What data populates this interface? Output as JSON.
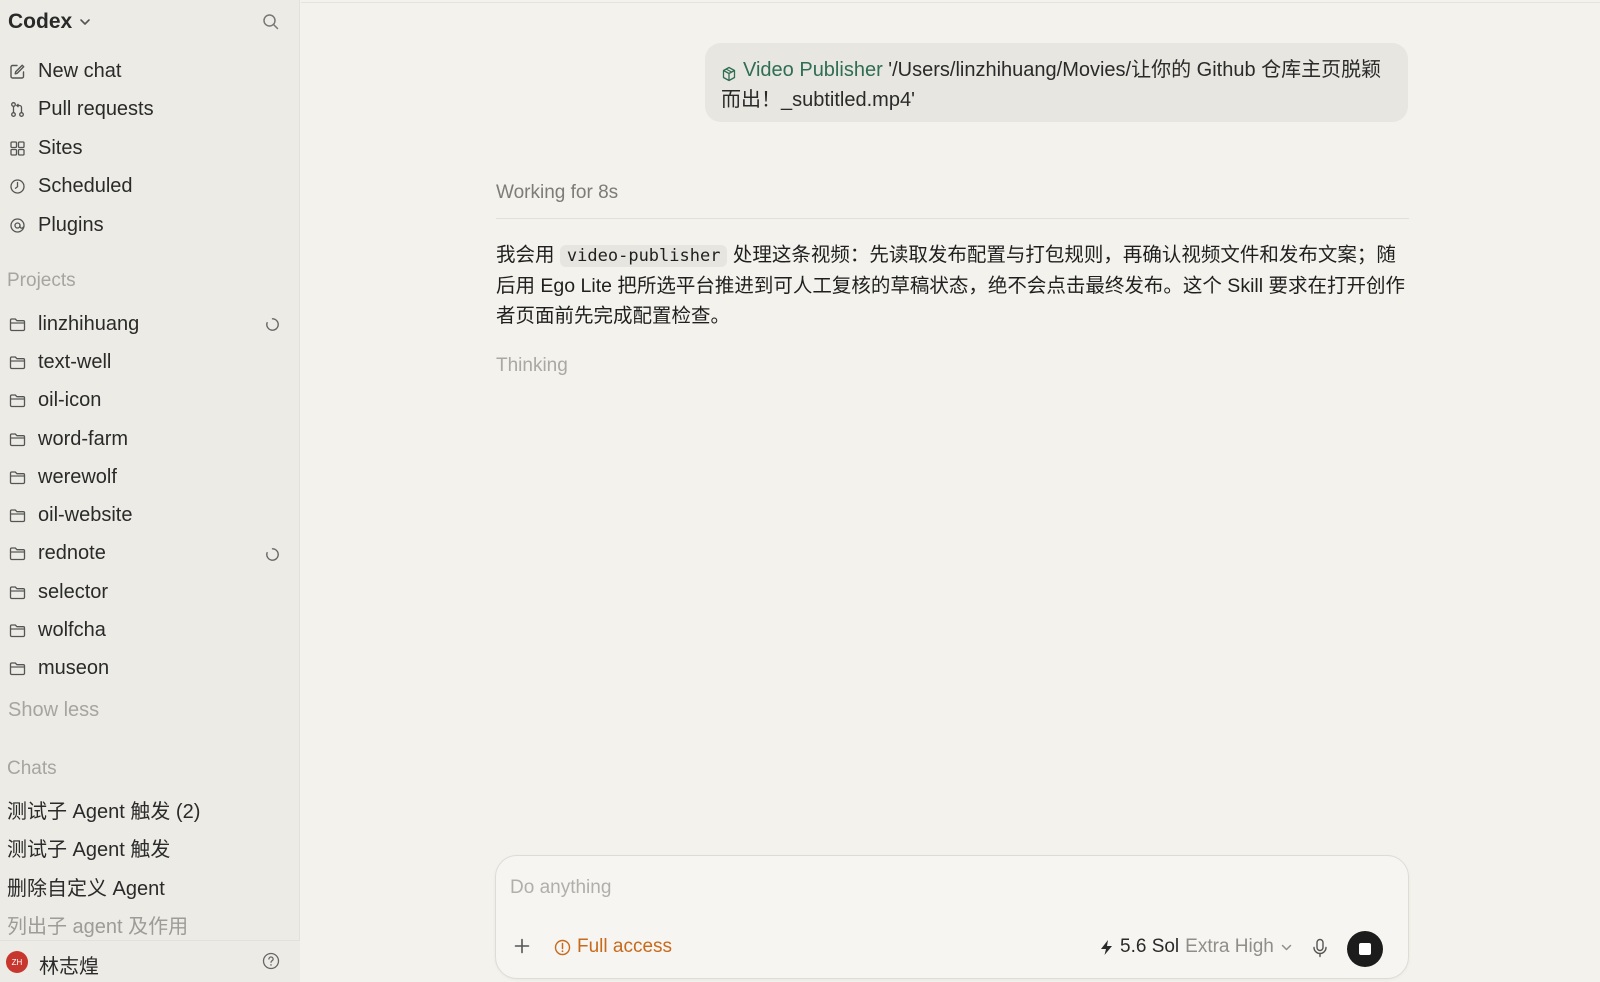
{
  "app": {
    "name": "Codex"
  },
  "sidebar": {
    "nav": [
      {
        "label": "New chat",
        "icon": "compose-icon"
      },
      {
        "label": "Pull requests",
        "icon": "pull-request-icon"
      },
      {
        "label": "Sites",
        "icon": "grid-icon"
      },
      {
        "label": "Scheduled",
        "icon": "clock-icon"
      },
      {
        "label": "Plugins",
        "icon": "at-icon"
      }
    ],
    "projects_title": "Projects",
    "projects": [
      {
        "label": "linzhihuang",
        "loading": true
      },
      {
        "label": "text-well",
        "loading": false
      },
      {
        "label": "oil-icon",
        "loading": false
      },
      {
        "label": "word-farm",
        "loading": false
      },
      {
        "label": "werewolf",
        "loading": false
      },
      {
        "label": "oil-website",
        "loading": false
      },
      {
        "label": "rednote",
        "loading": true
      },
      {
        "label": "selector",
        "loading": false
      },
      {
        "label": "wolfcha",
        "loading": false
      },
      {
        "label": "museon",
        "loading": false
      }
    ],
    "show_less": "Show less",
    "chats_title": "Chats",
    "chats": [
      "测试子 Agent 触发 (2)",
      "测试子 Agent 触发",
      "删除自定义 Agent",
      "列出子 agent 及作用"
    ],
    "user": {
      "initials": "ZH",
      "name": "林志煌"
    }
  },
  "conversation": {
    "user_message": {
      "skill_label": "Video Publisher",
      "text": " '/Users/linzhihuang/Movies/让你的 Github 仓库主页脱颖而出！_subtitled.mp4'"
    },
    "status": "Working for 8s",
    "reply": {
      "before_code": "我会用 ",
      "code": "video-publisher",
      "after_code": " 处理这条视频：先读取发布配置与打包规则，再确认视频文件和发布文案；随后用 Ego Lite 把所选平台推进到可人工复核的草稿状态，绝不会点击最终发布。这个 Skill 要求在打开创作者页面前先完成配置检查。"
    },
    "thinking": "Thinking"
  },
  "composer": {
    "placeholder": "Do anything",
    "access_label": "Full access",
    "model_name": "5.6 Sol",
    "model_effort": "Extra High"
  },
  "colors": {
    "background": "#f3f2ec",
    "sidebar": "#ecebe5",
    "accent_green": "#2f6d54",
    "warning_orange": "#c76a1c",
    "avatar_red": "#c8372d"
  }
}
